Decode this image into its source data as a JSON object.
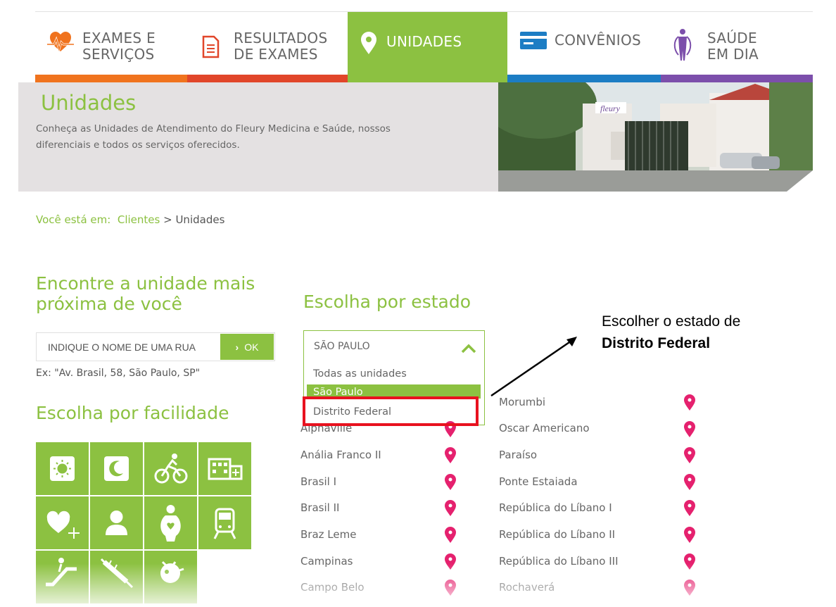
{
  "nav": {
    "items": [
      {
        "label": "EXAMES E\nSERVIÇOS",
        "icon": "heartbeat-icon",
        "bar_color": "#f0731e"
      },
      {
        "label": "RESULTADOS\nDE EXAMES",
        "icon": "document-icon",
        "bar_color": "#e1462a"
      },
      {
        "label": "UNIDADES",
        "icon": "location-pin-icon",
        "bar_color": "#8cc141",
        "active": true
      },
      {
        "label": "CONVÊNIOS",
        "icon": "card-icon",
        "bar_color": "#1c7dc4"
      },
      {
        "label": "SAÚDE\nEM DIA",
        "icon": "exercise-person-icon",
        "bar_color": "#7c4fab"
      }
    ]
  },
  "banner": {
    "title": "Unidades",
    "description": "Conheça as Unidades de Atendimento do Fleury Medicina e Saúde, nossos diferenciais e todos os serviços oferecidos.",
    "photo_logo": "fleury"
  },
  "breadcrumb": {
    "prefix": "Você está em:",
    "link": "Clientes",
    "separator": ">",
    "current": "Unidades"
  },
  "find": {
    "heading": "Encontre a unidade mais próxima de você",
    "placeholder": "INDIQUE O NOME DE UMA RUA",
    "ok_label": "OK",
    "example": "Ex: \"Av. Brasil, 58, São Paulo, SP\""
  },
  "facility": {
    "heading": "Escolha por facilidade",
    "icons": [
      "sun-icon",
      "moon-icon",
      "cyclist-icon",
      "hospital-building-icon",
      "heart-plus-icon",
      "person-icon",
      "pregnant-woman-icon",
      "train-icon",
      "escalator-icon",
      "syringe-icon",
      "vaccine-icon"
    ]
  },
  "state": {
    "heading": "Escolha por estado",
    "selected": "SÃO PAULO",
    "options": [
      "Todas as unidades",
      "São Paulo",
      "Distrito Federal"
    ]
  },
  "units": {
    "left": [
      "Alphaville",
      "Anália Franco II",
      "Brasil I",
      "Brasil II",
      "Braz Leme",
      "Campinas",
      "Campo Belo"
    ],
    "right": [
      "Morumbi",
      "Oscar Americano",
      "Paraíso",
      "Ponte Estaiada",
      "República do Líbano I",
      "República do Líbano II",
      "República do Líbano III",
      "Rochaverá"
    ]
  },
  "annotation": {
    "line1": "Escolher o estado de",
    "line2": "Distrito Federal"
  },
  "colors": {
    "green": "#8cc141",
    "pin": "#e5216e",
    "highlight": "#e8121f"
  }
}
